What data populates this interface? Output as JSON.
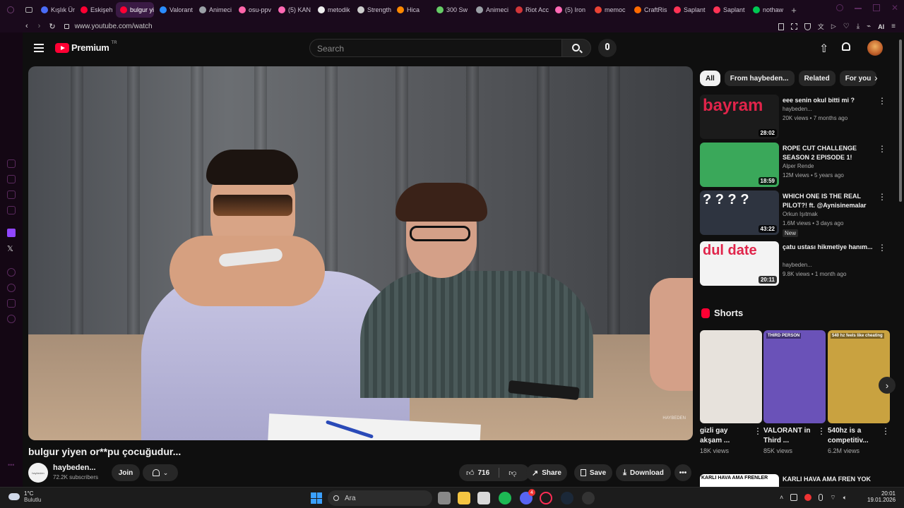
{
  "browser": {
    "tabs": [
      {
        "label": "Kışlık Ür",
        "color": "#4a6cf7"
      },
      {
        "label": "Eskişeh",
        "color": "#ff0033"
      },
      {
        "label": "bulgur yiye",
        "color": "#ff0033",
        "active": true
      },
      {
        "label": "Valorant",
        "color": "#2a8cff"
      },
      {
        "label": "Animeci",
        "color": "#9aa0a6"
      },
      {
        "label": "osu-ppv",
        "color": "#ff66aa"
      },
      {
        "label": "(5) KAN",
        "color": "#ff69b4"
      },
      {
        "label": "metodik",
        "color": "#eeeeee"
      },
      {
        "label": "Strength",
        "color": "#cccccc"
      },
      {
        "label": "Hica",
        "color": "#ff8800"
      },
      {
        "label": "300 Sw",
        "color": "#66cc66"
      },
      {
        "label": "Animeci",
        "color": "#9aa0a6"
      },
      {
        "label": "Riot Acc",
        "color": "#d13639"
      },
      {
        "label": "(5) Iron",
        "color": "#ff69b4"
      },
      {
        "label": "memoc",
        "color": "#ea4335"
      },
      {
        "label": "CraftRis",
        "color": "#ff6a00"
      },
      {
        "label": "Saplant",
        "color": "#ff3355"
      },
      {
        "label": "Saplant",
        "color": "#ff3355"
      },
      {
        "label": "nothaw",
        "color": "#00c853"
      }
    ],
    "new_tab": "+",
    "url": "www.youtube.com/watch",
    "ai_label": "AI"
  },
  "youtube": {
    "logo": "Premium",
    "logo_sup": "TR",
    "search_placeholder": "Search",
    "video_title": "bulgur yiyen or**pu çocuğudur...",
    "watermark": "HAYBEDEN",
    "channel": {
      "name": "haybeden...",
      "subs": "72.2K subscribers",
      "avatar_text": "haybeden",
      "join": "Join"
    },
    "actions": {
      "likes": "716",
      "share": "Share",
      "save": "Save",
      "download": "Download"
    },
    "chips": [
      "All",
      "From haybeden...",
      "Related",
      "For you"
    ],
    "recommendations": [
      {
        "title": "eee senin okul bitti mi ?",
        "channel": "haybeden...",
        "meta": "20K views • 7 months ago",
        "duration": "28:02",
        "thumb_text": "bayram",
        "thumb_bg": "#1b1b1b",
        "thumb_fg": "#e0244a"
      },
      {
        "title": "ROPE CUT CHALLENGE SEASON 2 EPISODE 1!",
        "channel": "Alper Rende",
        "meta": "12M views • 5 years ago",
        "duration": "18:59",
        "thumb_text": "",
        "thumb_bg": "#3aa85a",
        "thumb_fg": "#ffffff"
      },
      {
        "title": "WHICH ONE IS THE REAL PILOT?! ft. @Aynisinemalar",
        "channel": "Orkun Işıtmak",
        "meta": "1.6M views • 3 days ago",
        "badge": "New",
        "duration": "43:22",
        "thumb_text": "? ? ? ?",
        "thumb_bg": "#2e3440",
        "thumb_fg": "#ffffff"
      },
      {
        "title": "çatu ustası hikmetiye hanım...",
        "channel": "haybeden...",
        "meta": "9.8K views • 1 month ago",
        "duration": "20:11",
        "thumb_text": "dul date",
        "thumb_bg": "#f3f3f3",
        "thumb_fg": "#e0244a"
      }
    ],
    "shorts_title": "Shorts",
    "shorts": [
      {
        "title": "gizli gay akşam ...",
        "views": "18K views",
        "bg": "#e7e2dc"
      },
      {
        "title": "VALORANT in Third ...",
        "views": "85K views",
        "bg": "#6a52b8",
        "overlay": "THIRD PERSON"
      },
      {
        "title": "540hz is a competitiv...",
        "views": "6.2M views",
        "bg": "#c9a240",
        "overlay": "540 hz feels like cheating"
      }
    ],
    "next_rec": {
      "title": "KARLI HAVA AMA FREN YOK",
      "thumb_text": "KARLI HAVA AMA FRENLER"
    }
  },
  "taskbar": {
    "weather_temp": "1°C",
    "weather_desc": "Bulutlu",
    "search_label": "Ara",
    "time": "20:01",
    "date": "19.01.2026",
    "discord_badge": "4"
  }
}
